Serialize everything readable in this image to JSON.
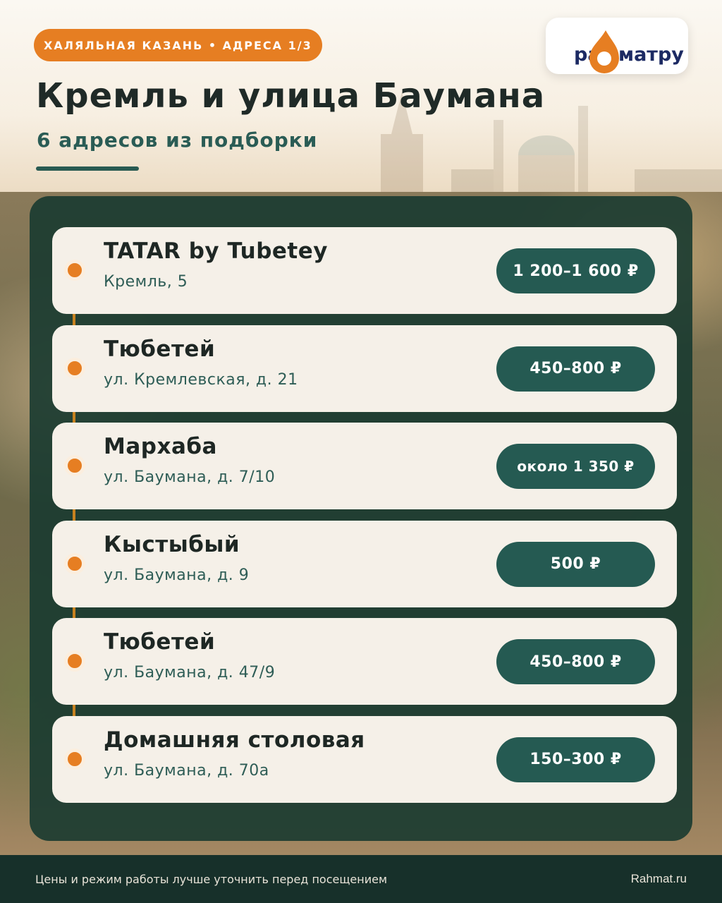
{
  "header": {
    "tag": "ХАЛЯЛЬНАЯ КАЗАНЬ • АДРЕСА 1/3",
    "title": "Кремль и улица Баумана",
    "subtitle": "6 адресов из подборки"
  },
  "logo": {
    "text_left": "ра",
    "text_right": "матру",
    "icon": "drop-logo-icon"
  },
  "places": [
    {
      "name": "TATAR by Tubetey",
      "address": "Кремль, 5",
      "price": "1 200–1 600 ₽"
    },
    {
      "name": "Тюбетей",
      "address": "ул. Кремлевская, д. 21",
      "price": "450–800 ₽"
    },
    {
      "name": "Мархаба",
      "address": "ул. Баумана, д. 7/10",
      "price": "около 1 350 ₽"
    },
    {
      "name": "Кыстыбый",
      "address": "ул. Баумана, д. 9",
      "price": "500 ₽"
    },
    {
      "name": "Тюбетей",
      "address": "ул. Баумана, д. 47/9",
      "price": "450–800 ₽"
    },
    {
      "name": "Домашняя столовая",
      "address": "ул. Баумана, д. 70а",
      "price": "150–300 ₽"
    }
  ],
  "footer": {
    "note": "Цены и режим работы лучше уточнить перед посещением",
    "site": "Rahmat.ru"
  },
  "colors": {
    "accent_orange": "#e67e22",
    "dark_green": "#255a52",
    "panel_green": "#183a30",
    "card_bg": "#f5f0e8"
  }
}
